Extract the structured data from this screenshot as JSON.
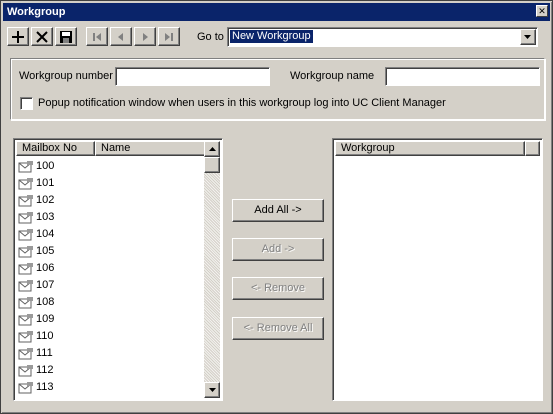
{
  "window": {
    "title": "Workgroup",
    "close_icon": "close-icon"
  },
  "toolbar": {
    "buttons": [
      {
        "name": "add-icon",
        "enabled": true
      },
      {
        "name": "delete-icon",
        "enabled": true
      },
      {
        "name": "save-icon",
        "enabled": true
      },
      {
        "name": "first-record-icon",
        "enabled": false
      },
      {
        "name": "previous-record-icon",
        "enabled": false
      },
      {
        "name": "next-record-icon",
        "enabled": false
      },
      {
        "name": "last-record-icon",
        "enabled": false
      }
    ],
    "goto_label": "Go to",
    "goto_value": "New Workgroup"
  },
  "form": {
    "number_label": "Workgroup number",
    "number_value": "",
    "name_label": "Workgroup name",
    "name_value": "",
    "popup_label": "Popup notification window when users in this workgroup log into UC Client Manager",
    "popup_checked": false
  },
  "mailbox_list": {
    "columns": [
      "Mailbox No",
      "Name"
    ],
    "rows": [
      "100",
      "101",
      "102",
      "103",
      "104",
      "105",
      "106",
      "107",
      "108",
      "109",
      "110",
      "111",
      "112",
      "113"
    ]
  },
  "actions": {
    "add_all": "Add All ->",
    "add": "Add ->",
    "remove": "<- Remove",
    "remove_all": "<- Remove All"
  },
  "workgroup_list": {
    "columns": [
      "Workgroup"
    ],
    "rows": []
  },
  "colors": {
    "titlebar": "#0a246a",
    "face": "#d4d0c8",
    "selection": "#0a246a"
  }
}
